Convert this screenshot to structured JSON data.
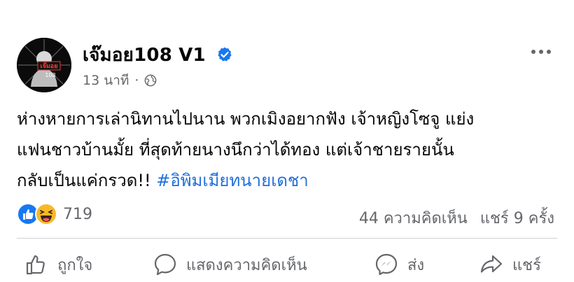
{
  "post": {
    "author": {
      "name": "เจ๊มอย108 V1",
      "avatar_text": "เจ๊มอย",
      "avatar_number": "108",
      "verified": true
    },
    "time": "13 นาที",
    "separator": "·",
    "privacy_icon": "globe-icon",
    "text_line1": "ห่างหายการเล่านิทานไปนาน พวกเมิงอยากฟัง เจ้าหญิงโซจู แย่ง",
    "text_line2": "แฟนชาวบ้านมั้ย ที่สุดท้ายนางนึกว่าได้ทอง แต่เจ้าชายรายนั้น",
    "text_line3_prefix": "กลับเป็นแค่กรวด!! ",
    "hashtag": "#อิพิมเมียทนายเดชา",
    "reactions": {
      "icons": [
        "like-icon",
        "haha-icon"
      ],
      "count": "719"
    },
    "comments_count": "44 ความคิดเห็น",
    "shares_count": "แชร์ 9 ครั้ง"
  },
  "actions": {
    "like": "ถูกใจ",
    "comment": "แสดงความคิดเห็น",
    "send": "ส่ง",
    "share": "แชร์"
  },
  "colors": {
    "text": "#050505",
    "secondary": "#65676b",
    "hashtag": "#216fdb",
    "verified": "#1877f2",
    "like": "#1877f2",
    "haha": "#f7b928"
  }
}
